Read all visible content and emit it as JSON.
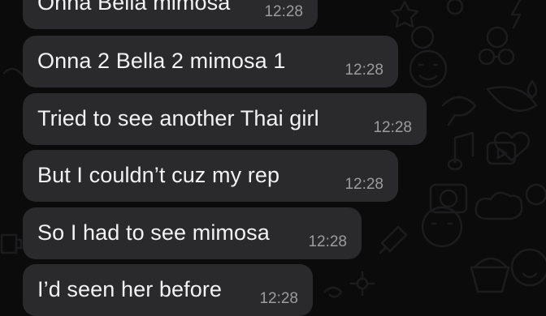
{
  "conversation": {
    "messages": [
      {
        "text": "Onna Bella mimosa",
        "time": "12:28"
      },
      {
        "text": "Onna 2 Bella 2 mimosa 1",
        "time": "12:28"
      },
      {
        "text": "Tried to see another Thai girl",
        "time": "12:28"
      },
      {
        "text": "But I couldn’t cuz my rep",
        "time": "12:28"
      },
      {
        "text": "So I had to see mimosa",
        "time": "12:28"
      },
      {
        "text": "I’d seen her before",
        "time": "12:28"
      }
    ]
  },
  "colors": {
    "background": "#0b0b0b",
    "bubble": "#2a2a2c",
    "message_text": "#f2f2f2",
    "timestamp": "#9c9c9f",
    "doodle": "#1c1c1e"
  },
  "wallpaper": {
    "icons": [
      "star-icon",
      "smiley-icon",
      "camera-icon",
      "music-note-icon",
      "moon-icon",
      "heart-icon",
      "play-icon",
      "lightning-icon"
    ]
  }
}
